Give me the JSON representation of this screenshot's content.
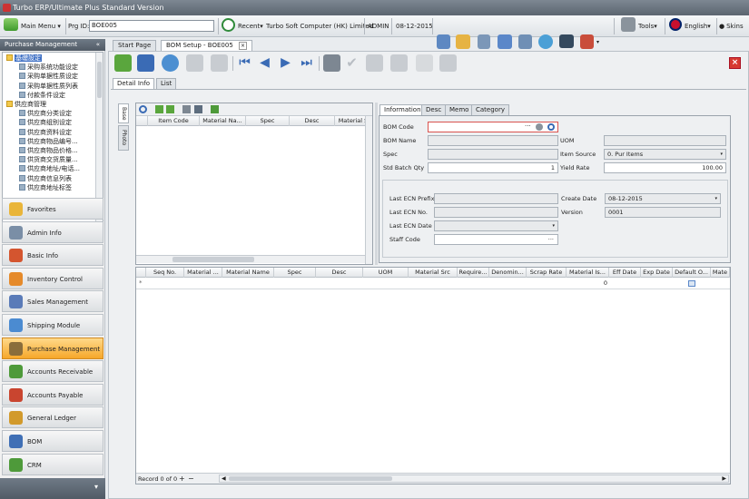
{
  "window": {
    "title": "Turbo ERP/Ultimate Plus Standard Version"
  },
  "toolbar": {
    "main_menu": "Main Menu",
    "prg_id_label": "Prg ID:",
    "prg_id_value": "BOE005",
    "recent": "Recent",
    "company": "Turbo Soft Computer (HK) Limited",
    "user": "ADMIN",
    "date": "08-12-2015",
    "tools": "Tools",
    "language": "English",
    "skins": "Skins"
  },
  "left_panel": {
    "title": "Purchase Management",
    "collapse": "«",
    "tree": [
      {
        "label": "基礎設定",
        "level": 0,
        "selected": true
      },
      {
        "label": "采购系统功能设定",
        "level": 1
      },
      {
        "label": "采购单据性质设定",
        "level": 1
      },
      {
        "label": "采购单据性质列表",
        "level": 1
      },
      {
        "label": "付款条件设定",
        "level": 1
      },
      {
        "label": "供应商管理",
        "level": 0
      },
      {
        "label": "供应商分类设定",
        "level": 1
      },
      {
        "label": "供应商组别设定",
        "level": 1
      },
      {
        "label": "供应商资料设定",
        "level": 1
      },
      {
        "label": "供应商物品编号...",
        "level": 1
      },
      {
        "label": "供应商物品价格...",
        "level": 1
      },
      {
        "label": "供货商交货质量...",
        "level": 1
      },
      {
        "label": "供应商地址/电话...",
        "level": 1
      },
      {
        "label": "供应商信息列表",
        "level": 1
      },
      {
        "label": "供应商地址标签",
        "level": 1
      }
    ],
    "modules": [
      {
        "label": "Favorites",
        "color": "#e9b53a"
      },
      {
        "label": "Admin Info",
        "color": "#7a8ea6"
      },
      {
        "label": "Basic Info",
        "color": "#d4552f"
      },
      {
        "label": "Inventory Control",
        "color": "#e58a2b"
      },
      {
        "label": "Sales Management",
        "color": "#5a7bb8"
      },
      {
        "label": "Shipping Module",
        "color": "#4b8bd1"
      },
      {
        "label": "Purchase Management",
        "color": "#8a6d3b",
        "active": true
      },
      {
        "label": "Accounts Receivable",
        "color": "#4e9a3a"
      },
      {
        "label": "Accounts Payable",
        "color": "#c9452f"
      },
      {
        "label": "General Ledger",
        "color": "#d29a2c"
      },
      {
        "label": "BOM",
        "color": "#3f6fb5"
      },
      {
        "label": "CRM",
        "color": "#4e9a3a"
      }
    ]
  },
  "doc_tabs": [
    {
      "label": "Start Page"
    },
    {
      "label": "BOM Setup - BOE005",
      "active": true,
      "close": "×"
    }
  ],
  "detail": {
    "close": "×",
    "sub_tabs": [
      "Detail Info",
      "List"
    ],
    "side_tabs": [
      "Base",
      "Photo"
    ],
    "left_grid_headers": [
      "Item Code",
      "Material Na...",
      "Spec",
      "Desc",
      "Material S"
    ],
    "info_tabs": [
      "Information",
      "Desc",
      "Memo",
      "Category"
    ],
    "fields": {
      "bom_code_label": "BOM Code",
      "bom_code_value": "",
      "bom_name_label": "BOM Name",
      "uom_label": "UOM",
      "spec_label": "Spec",
      "item_source_label": "Item Source",
      "item_source_value": "0. Pur Items",
      "std_batch_qty_label": "Std Batch Qty",
      "std_batch_qty_value": "1",
      "yield_rate_label": "Yield Rate",
      "yield_rate_value": "100.00",
      "last_ecn_prefix_label": "Last ECN Prefix",
      "last_ecn_no_label": "Last ECN No.",
      "last_ecn_date_label": "Last ECN Date",
      "staff_code_label": "Staff Code",
      "create_date_label": "Create Date",
      "create_date_value": "08-12-2015",
      "version_label": "Version",
      "version_value": "0001",
      "ellipsis": "···"
    },
    "bottom_grid": {
      "headers": [
        "Seq No.",
        "Material ...",
        "Material Name",
        "Spec",
        "Desc",
        "UOM",
        "Material Src",
        "Require...",
        "Denomin...",
        "Scrap Rate",
        "Material Is...",
        "Eff Date",
        "Exp Date",
        "Default O...",
        "Mate"
      ],
      "row_marker": "*",
      "material_is_value": "0"
    },
    "record_nav": {
      "text": "Record 0 of 0",
      "add": "+",
      "remove": "−"
    }
  }
}
